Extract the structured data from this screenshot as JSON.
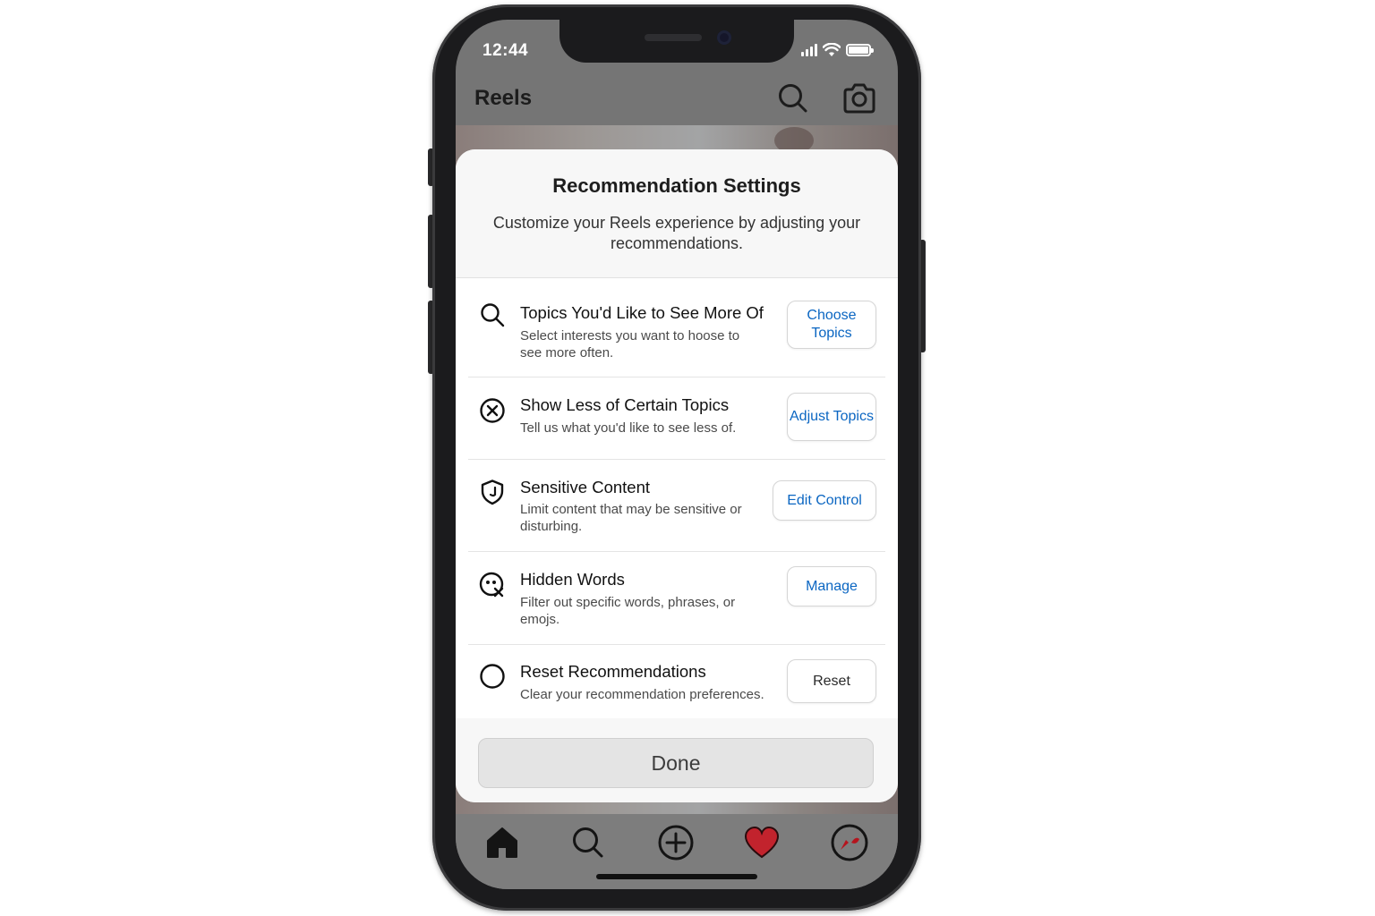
{
  "status_bar": {
    "time": "12:44"
  },
  "header": {
    "title": "Reels",
    "icons": [
      "search-icon",
      "camera-icon"
    ]
  },
  "modal": {
    "title": "Recommendation Settings",
    "subtitle": "Customize your Reels experience by adjusting your recommendations.",
    "items": [
      {
        "icon": "search-icon",
        "title": "Topics You'd Like to See More Of",
        "description": "Select interests you want to hoose to see more often.",
        "button": "Choose Topics"
      },
      {
        "icon": "close-circle-icon",
        "title": "Show Less of Certain Topics",
        "description": "Tell us what you'd like to see less of.",
        "button": "Adjust Topics"
      },
      {
        "icon": "shield-icon",
        "title": "Sensitive Content",
        "description": "Limit content that may be sensitive or disturbing.",
        "button": "Edit Control"
      },
      {
        "icon": "hidden-words-icon",
        "title": "Hidden Words",
        "description": "Filter out specific words, phrases, or emojs.",
        "button": "Manage"
      },
      {
        "icon": "circle-icon",
        "title": "Reset Recommendations",
        "description": "Clear your recommendation preferences.",
        "button": "Reset"
      }
    ],
    "done_label": "Done"
  },
  "bottom_nav": {
    "items": [
      "home-icon",
      "search-icon",
      "add-icon",
      "heart-icon",
      "profile-icon"
    ]
  },
  "colors": {
    "link_blue": "#0b66c2",
    "heart_red": "#c2232d",
    "overlay_gray": "#757575"
  }
}
